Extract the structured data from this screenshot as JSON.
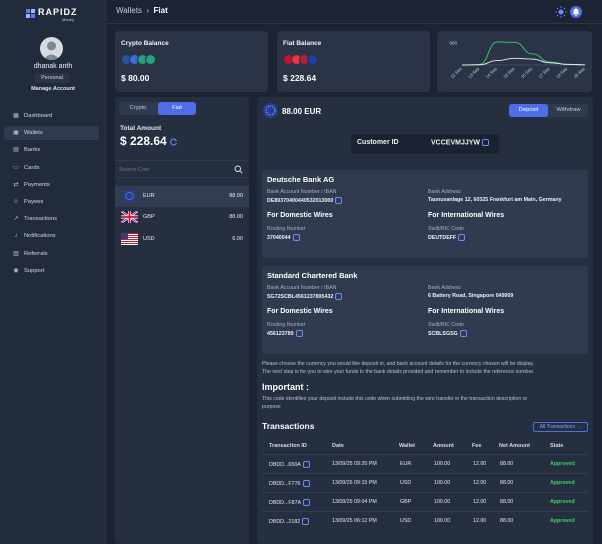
{
  "brand": {
    "name": "RAPIDZ",
    "sub": "Money"
  },
  "user": {
    "name": "dhanak anth",
    "role": "Personal",
    "manage_label": "Manage Account"
  },
  "nav": [
    {
      "label": "Dashboard",
      "icon": "dashboard-icon"
    },
    {
      "label": "Wallets",
      "icon": "wallet-icon",
      "active": true
    },
    {
      "label": "Banks",
      "icon": "bank-icon"
    },
    {
      "label": "Cards",
      "icon": "card-icon"
    },
    {
      "label": "Payments",
      "icon": "payments-icon"
    },
    {
      "label": "Payees",
      "icon": "payees-icon"
    },
    {
      "label": "Transactions",
      "icon": "transactions-icon"
    },
    {
      "label": "Notifications",
      "icon": "bell-icon"
    },
    {
      "label": "Referrals",
      "icon": "referrals-icon"
    },
    {
      "label": "Support",
      "icon": "support-icon"
    }
  ],
  "header": {
    "crumb_parent": "Wallets",
    "crumb_current": "Fiat"
  },
  "crypto_balance": {
    "title": "Crypto Balance",
    "value": "$ 80.00"
  },
  "fiat_balance": {
    "title": "Fiat Balance",
    "value": "$ 228.64"
  },
  "chart_data": {
    "type": "line",
    "y_tick": "600",
    "x": [
      "12 Sep",
      "13 Sep",
      "14 Sep",
      "15 Sep",
      "16 Sep",
      "17 Sep",
      "18 Sep",
      "19 Sep"
    ],
    "series": [
      {
        "values": [
          0,
          15,
          620,
          610,
          300,
          80,
          20,
          5
        ],
        "color": "#3fcf6a"
      },
      {
        "values": [
          0,
          5,
          120,
          180,
          160,
          60,
          15,
          5
        ],
        "color": "#e8ecf3"
      }
    ],
    "ylim": [
      0,
      700
    ]
  },
  "left": {
    "tab_crypto": "Crypto",
    "tab_fiat": "Fiat",
    "total_label": "Total Amount",
    "total_value": "$ 228.64",
    "search_placeholder": "Search Coin",
    "coins": [
      {
        "name": "EUR",
        "value": "88.00"
      },
      {
        "name": "GBP",
        "value": "88.00"
      },
      {
        "name": "USD",
        "value": "6.00"
      }
    ]
  },
  "right": {
    "balance": "88.00 EUR",
    "tab_deposit": "Deposit",
    "tab_withdraw": "Withdraw",
    "customer_id_label": "Customer ID",
    "customer_id": "VCCEVMJJYW",
    "banks": [
      {
        "name": "Deutsche Bank AG",
        "acct_label": "Bank Account Number / IBAN",
        "acct": "DE89370400440532013000",
        "addr_label": "Bank Address",
        "addr": "Taunusanlage 12, 60325 Frankfurt am Main, Germany",
        "dom": "For Domestic Wires",
        "intl": "For International Wires",
        "routing_label": "Routing Number",
        "routing": "37040044",
        "swift_label": "Swift/BIC Code",
        "swift": "DEUTDEFF"
      },
      {
        "name": "Standard Chartered Bank",
        "acct_label": "Bank Account Number / IBAN",
        "acct": "SG72SCBL4561237895432",
        "addr_label": "Bank Address",
        "addr": "6 Battery Road, Singapore 049909",
        "dom": "For Domestic Wires",
        "intl": "For International Wires",
        "routing_label": "Routing Number",
        "routing": "456123789",
        "swift_label": "Swift/BIC Code",
        "swift": "SCBLSGSG"
      }
    ],
    "note_line1": "Please choose the currency you would like deposit in, and bank account details for the currency chosen will be display.",
    "note_line2": "The next step is for you to wire your funds to the bank details provided and remember to include the reference number.",
    "important_title": "Important :",
    "important_line1": "This code identifies your deposit include this code when submitting the wire transfer in the transaction description or",
    "important_line2": "purpose",
    "tx_title": "Transactions",
    "all_tx_label": "All Transactions  →",
    "tx_headers": [
      "Transaction ID",
      "Date",
      "Wallet",
      "Amount",
      "Fee",
      "Net Amount",
      "State"
    ],
    "tx_rows": [
      {
        "id": "DBDD...650A",
        "date": "13/09/25 09:20 PM",
        "wallet": "EUR",
        "amount": "100.00",
        "fee": "12.00",
        "net": "88.00",
        "state": "Approved"
      },
      {
        "id": "DBDD...F776",
        "date": "13/09/25 09:15 PM",
        "wallet": "USD",
        "amount": "100.00",
        "fee": "12.00",
        "net": "88.00",
        "state": "Approved"
      },
      {
        "id": "DBDD...F87A",
        "date": "13/09/25 09:04 PM",
        "wallet": "GBP",
        "amount": "100.00",
        "fee": "12.00",
        "net": "88.00",
        "state": "Approved"
      },
      {
        "id": "DBDD...2182",
        "date": "13/09/25 06:12 PM",
        "wallet": "USD",
        "amount": "100.00",
        "fee": "12.00",
        "net": "88.00",
        "state": "Approved"
      }
    ]
  }
}
